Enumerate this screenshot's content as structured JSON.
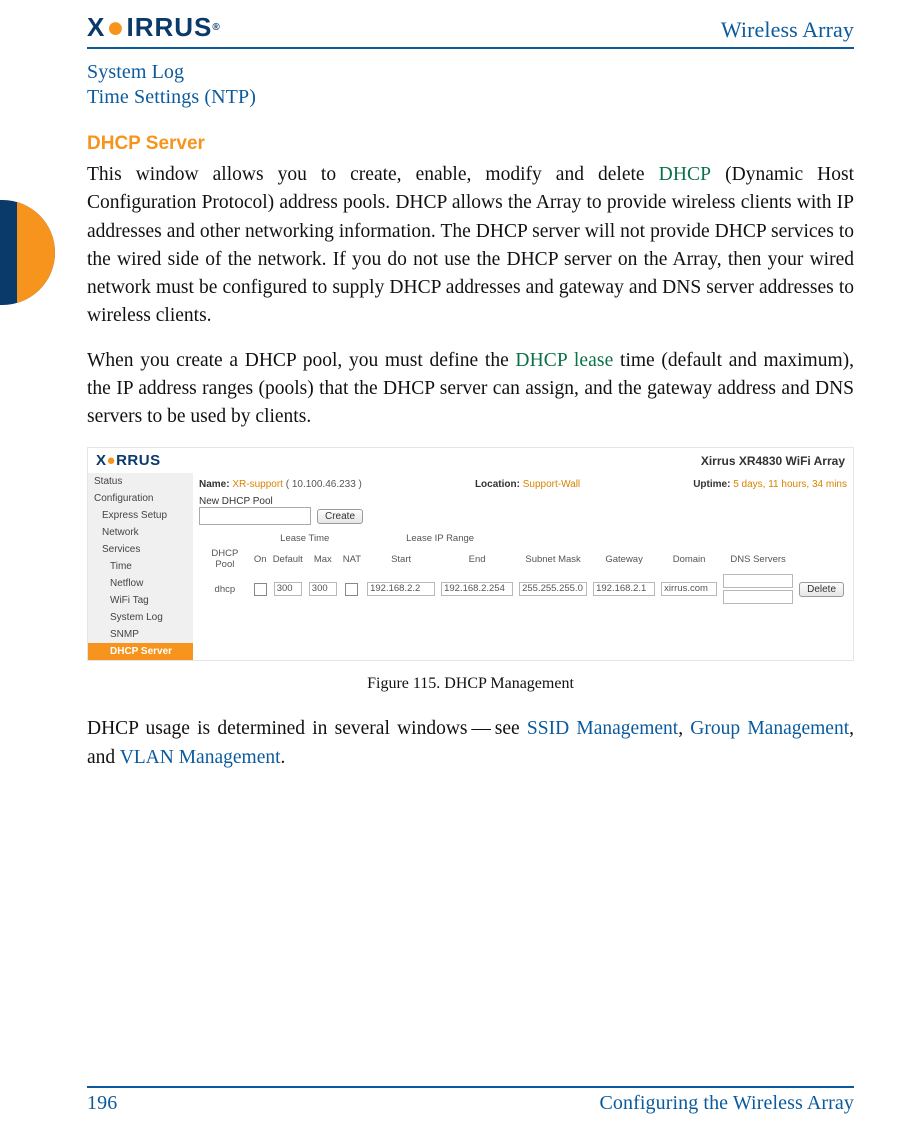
{
  "header": {
    "brand_text": "XIRRUS",
    "doc_title": "Wireless Array"
  },
  "nav_links": {
    "system_log": "System Log",
    "time_settings": "Time Settings (NTP)"
  },
  "section": {
    "heading": "DHCP Server",
    "para1_a": "This window allows you to create, enable, modify and delete ",
    "para1_link1": "DHCP",
    "para1_b": " (Dynamic Host Configuration Protocol) address pools. DHCP allows the Array to provide wireless clients with IP addresses and other networking information. The DHCP server will not provide DHCP services to the wired side of the network. If you do not use the DHCP server on the Array, then your wired network must be configured to supply DHCP addresses and gateway and DNS server addresses to wireless clients.",
    "para2_a": "When you create a DHCP pool, you must define the ",
    "para2_link1": "DHCP lease",
    "para2_b": " time (default and maximum), the IP address ranges (pools) that the DHCP server can assign, and the gateway address and DNS servers to be used by clients.",
    "para3_a": "DHCP usage is determined in several windows — see ",
    "para3_link1": "SSID Management",
    "para3_sep1": ", ",
    "para3_link2": "Group Management",
    "para3_sep2": ", and ",
    "para3_link3": "VLAN Management",
    "para3_end": "."
  },
  "figure": {
    "model": "Xirrus XR4830 WiFi Array",
    "meta": {
      "name_label": "Name:",
      "name_value": "XR-support",
      "name_ip": "( 10.100.46.233 )",
      "location_label": "Location:",
      "location_value": "Support-Wall",
      "uptime_label": "Uptime:",
      "uptime_value": "5 days, 11 hours, 34 mins"
    },
    "sidebar": {
      "items": [
        {
          "label": "Status",
          "cls": "item"
        },
        {
          "label": "Configuration",
          "cls": "item"
        },
        {
          "label": "Express Setup",
          "cls": "item sub"
        },
        {
          "label": "Network",
          "cls": "item sub"
        },
        {
          "label": "Services",
          "cls": "item sub"
        },
        {
          "label": "Time",
          "cls": "item subsub"
        },
        {
          "label": "Netflow",
          "cls": "item subsub"
        },
        {
          "label": "WiFi Tag",
          "cls": "item subsub"
        },
        {
          "label": "System Log",
          "cls": "item subsub"
        },
        {
          "label": "SNMP",
          "cls": "item subsub"
        },
        {
          "label": "DHCP Server",
          "cls": "item subsub sel"
        }
      ]
    },
    "pool": {
      "new_label": "New DHCP Pool",
      "create_btn": "Create"
    },
    "table": {
      "group_headers": {
        "lease_time": "Lease Time",
        "lease_range": "Lease IP Range"
      },
      "headers": [
        "DHCP Pool",
        "On",
        "Default",
        "Max",
        "NAT",
        "Start",
        "End",
        "Subnet Mask",
        "Gateway",
        "Domain",
        "DNS Servers",
        ""
      ],
      "row": {
        "pool": "dhcp",
        "on_checked": false,
        "def": "300",
        "max": "300",
        "nat_checked": false,
        "start": "192.168.2.2",
        "end": "192.168.2.254",
        "mask": "255.255.255.0",
        "gw": "192.168.2.1",
        "domain": "xirrus.com",
        "dns1": "",
        "dns2": "",
        "delete_btn": "Delete"
      }
    },
    "caption": "Figure 115. DHCP Management"
  },
  "footer": {
    "page_number": "196",
    "section_title": "Configuring the Wireless Array"
  }
}
